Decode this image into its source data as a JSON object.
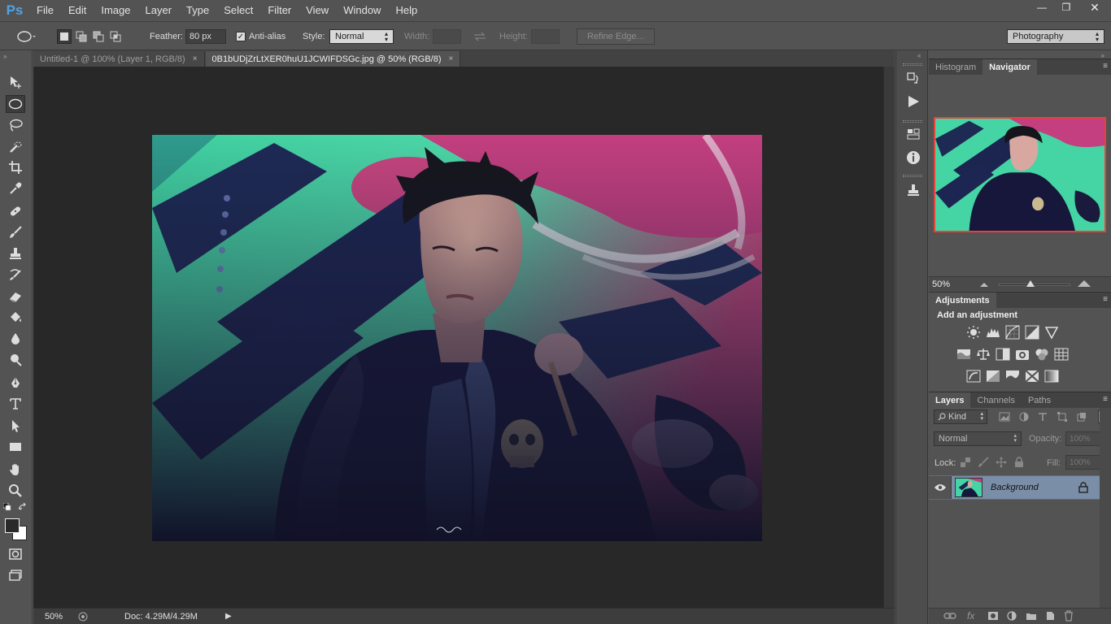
{
  "app": {
    "logo": "Ps",
    "menu": [
      "File",
      "Edit",
      "Image",
      "Layer",
      "Type",
      "Select",
      "Filter",
      "View",
      "Window",
      "Help"
    ],
    "window_controls": {
      "minimize": "—",
      "restore": "❐",
      "close": "✕"
    }
  },
  "options_bar": {
    "feather_label": "Feather:",
    "feather_value": "80 px",
    "antialias_label": "Anti-alias",
    "antialias_checked": "✓",
    "style_label": "Style:",
    "style_value": "Normal",
    "width_label": "Width:",
    "height_label": "Height:",
    "refine_edge_label": "Refine Edge...",
    "workspace_value": "Photography"
  },
  "tabs": [
    {
      "label": "Untitled-1 @ 100% (Layer 1, RGB/8)",
      "close": "×"
    },
    {
      "label": "0B1bUDjZrLtXER0huU1JCWIFDSGc.jpg @ 50% (RGB/8)",
      "close": "×"
    }
  ],
  "status_bar": {
    "zoom": "50%",
    "doc_info": "Doc: 4.29M/4.29M"
  },
  "navigator_panel": {
    "tabs": [
      "Histogram",
      "Navigator"
    ],
    "zoom": "50%"
  },
  "adjustments_panel": {
    "tab": "Adjustments",
    "heading": "Add an adjustment"
  },
  "layers_panel": {
    "tabs": [
      "Layers",
      "Channels",
      "Paths"
    ],
    "kind_label": "Kind",
    "blend_mode": "Normal",
    "opacity_label": "Opacity:",
    "opacity_value": "100%",
    "lock_label": "Lock:",
    "fill_label": "Fill:",
    "fill_value": "100%",
    "layers": [
      {
        "name": "Background"
      }
    ],
    "footer_labels": {
      "link": "⊖",
      "fx": "fx"
    }
  },
  "colors": {
    "ui_bg": "#535353",
    "canvas_bg": "#282828",
    "accent_blue": "#4fa3e8",
    "selected_layer": "#7b8ea8",
    "navigator_frame": "#e8413a"
  },
  "icons": [
    "move-icon",
    "elliptical-marquee-icon",
    "lasso-icon",
    "quick-selection-icon",
    "crop-icon",
    "eyedropper-icon",
    "healing-brush-icon",
    "brush-icon",
    "clone-stamp-icon",
    "history-brush-icon",
    "eraser-icon",
    "paint-bucket-icon",
    "blur-icon",
    "dodge-icon",
    "pen-icon",
    "type-icon",
    "path-selection-icon",
    "rectangle-icon",
    "hand-icon",
    "zoom-icon"
  ]
}
